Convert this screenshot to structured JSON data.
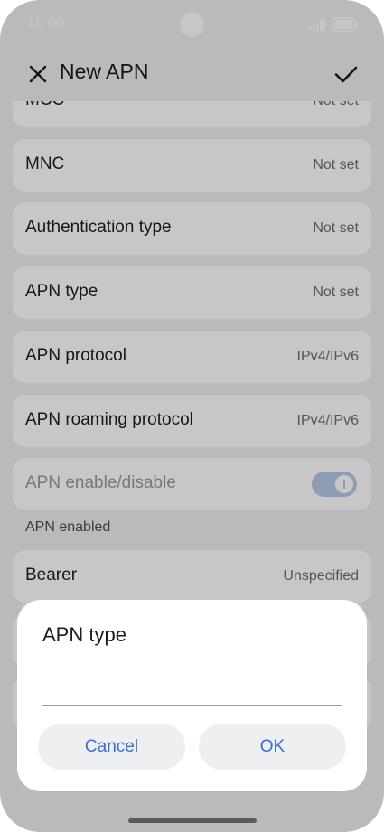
{
  "status_bar": {
    "time": "10:00"
  },
  "app_bar": {
    "title": "New APN",
    "close_icon": "close-icon",
    "confirm_icon": "check-icon"
  },
  "settings": {
    "partial_top": {
      "label": "MCC",
      "value": "Not set"
    },
    "items": [
      {
        "label": "MNC",
        "value": "Not set"
      },
      {
        "label": "Authentication type",
        "value": "Not set"
      },
      {
        "label": "APN type",
        "value": "Not set"
      },
      {
        "label": "APN protocol",
        "value": "IPv4/IPv6"
      },
      {
        "label": "APN roaming protocol",
        "value": "IPv4/IPv6"
      }
    ],
    "apn_enable": {
      "label": "APN enable/disable",
      "enabled": true,
      "caption": "APN enabled"
    },
    "bearer": {
      "label": "Bearer",
      "value": "Unspecified"
    }
  },
  "dialog": {
    "title": "APN type",
    "input_value": "",
    "cancel_label": "Cancel",
    "ok_label": "OK"
  },
  "colors": {
    "accent": "#3a6bd6",
    "toggle_on_disabled": "#b8c8ea",
    "screen_bg": "#efeff2"
  }
}
